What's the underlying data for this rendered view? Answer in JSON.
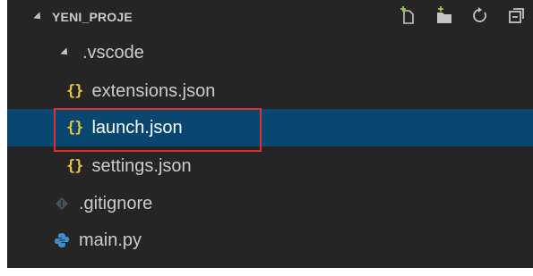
{
  "explorer": {
    "project_title": "YENI_PROJE",
    "actions": [
      {
        "name": "new-file",
        "icon": "new-file-icon"
      },
      {
        "name": "new-folder",
        "icon": "new-folder-icon"
      },
      {
        "name": "refresh",
        "icon": "refresh-icon"
      },
      {
        "name": "collapse-all",
        "icon": "collapse-all-icon"
      }
    ],
    "tree": {
      "folder_vscode": ".vscode",
      "file_extensions": "extensions.json",
      "file_launch": "launch.json",
      "file_settings": "settings.json",
      "file_gitignore": ".gitignore",
      "file_main": "main.py"
    },
    "json_icon_glyph": "{}",
    "selected_file": "launch.json"
  },
  "colors": {
    "panel_bg": "#252526",
    "selection_bg": "#094771",
    "json_icon": "#e8c33b",
    "highlight_border": "#e0302e",
    "python_icon": "#3c8fcf"
  }
}
